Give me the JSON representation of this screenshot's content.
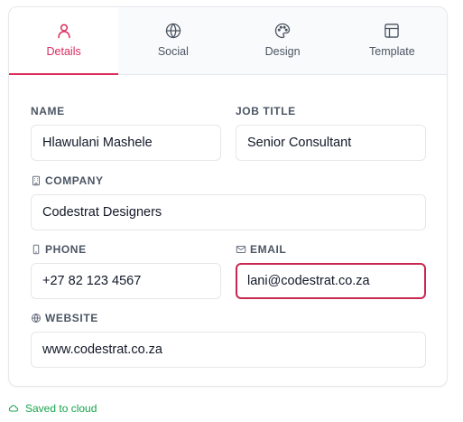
{
  "tabs": [
    {
      "label": "Details",
      "icon": "user-icon",
      "active": true
    },
    {
      "label": "Social",
      "icon": "globe-icon",
      "active": false
    },
    {
      "label": "Design",
      "icon": "palette-icon",
      "active": false
    },
    {
      "label": "Template",
      "icon": "layout-icon",
      "active": false
    }
  ],
  "form": {
    "name": {
      "label": "NAME",
      "value": "Hlawulani Mashele"
    },
    "job_title": {
      "label": "JOB TITLE",
      "value": "Senior Consultant"
    },
    "company": {
      "label": "COMPANY",
      "icon": "building-icon",
      "value": "Codestrat Designers"
    },
    "phone": {
      "label": "PHONE",
      "icon": "phone-icon",
      "value": "+27 82 123 4567"
    },
    "email": {
      "label": "EMAIL",
      "icon": "mail-icon",
      "value": "lani@codestrat.co.za",
      "focused": true
    },
    "website": {
      "label": "WEBSITE",
      "icon": "globe-icon",
      "value": "www.codestrat.co.za"
    }
  },
  "status": {
    "text": "Saved to cloud",
    "icon": "cloud-icon"
  },
  "colors": {
    "accent": "#dc2b5c",
    "focus_border": "#c8284f",
    "status_green": "#16a34a",
    "label_gray": "#4b5563",
    "border": "#e5e7eb"
  }
}
